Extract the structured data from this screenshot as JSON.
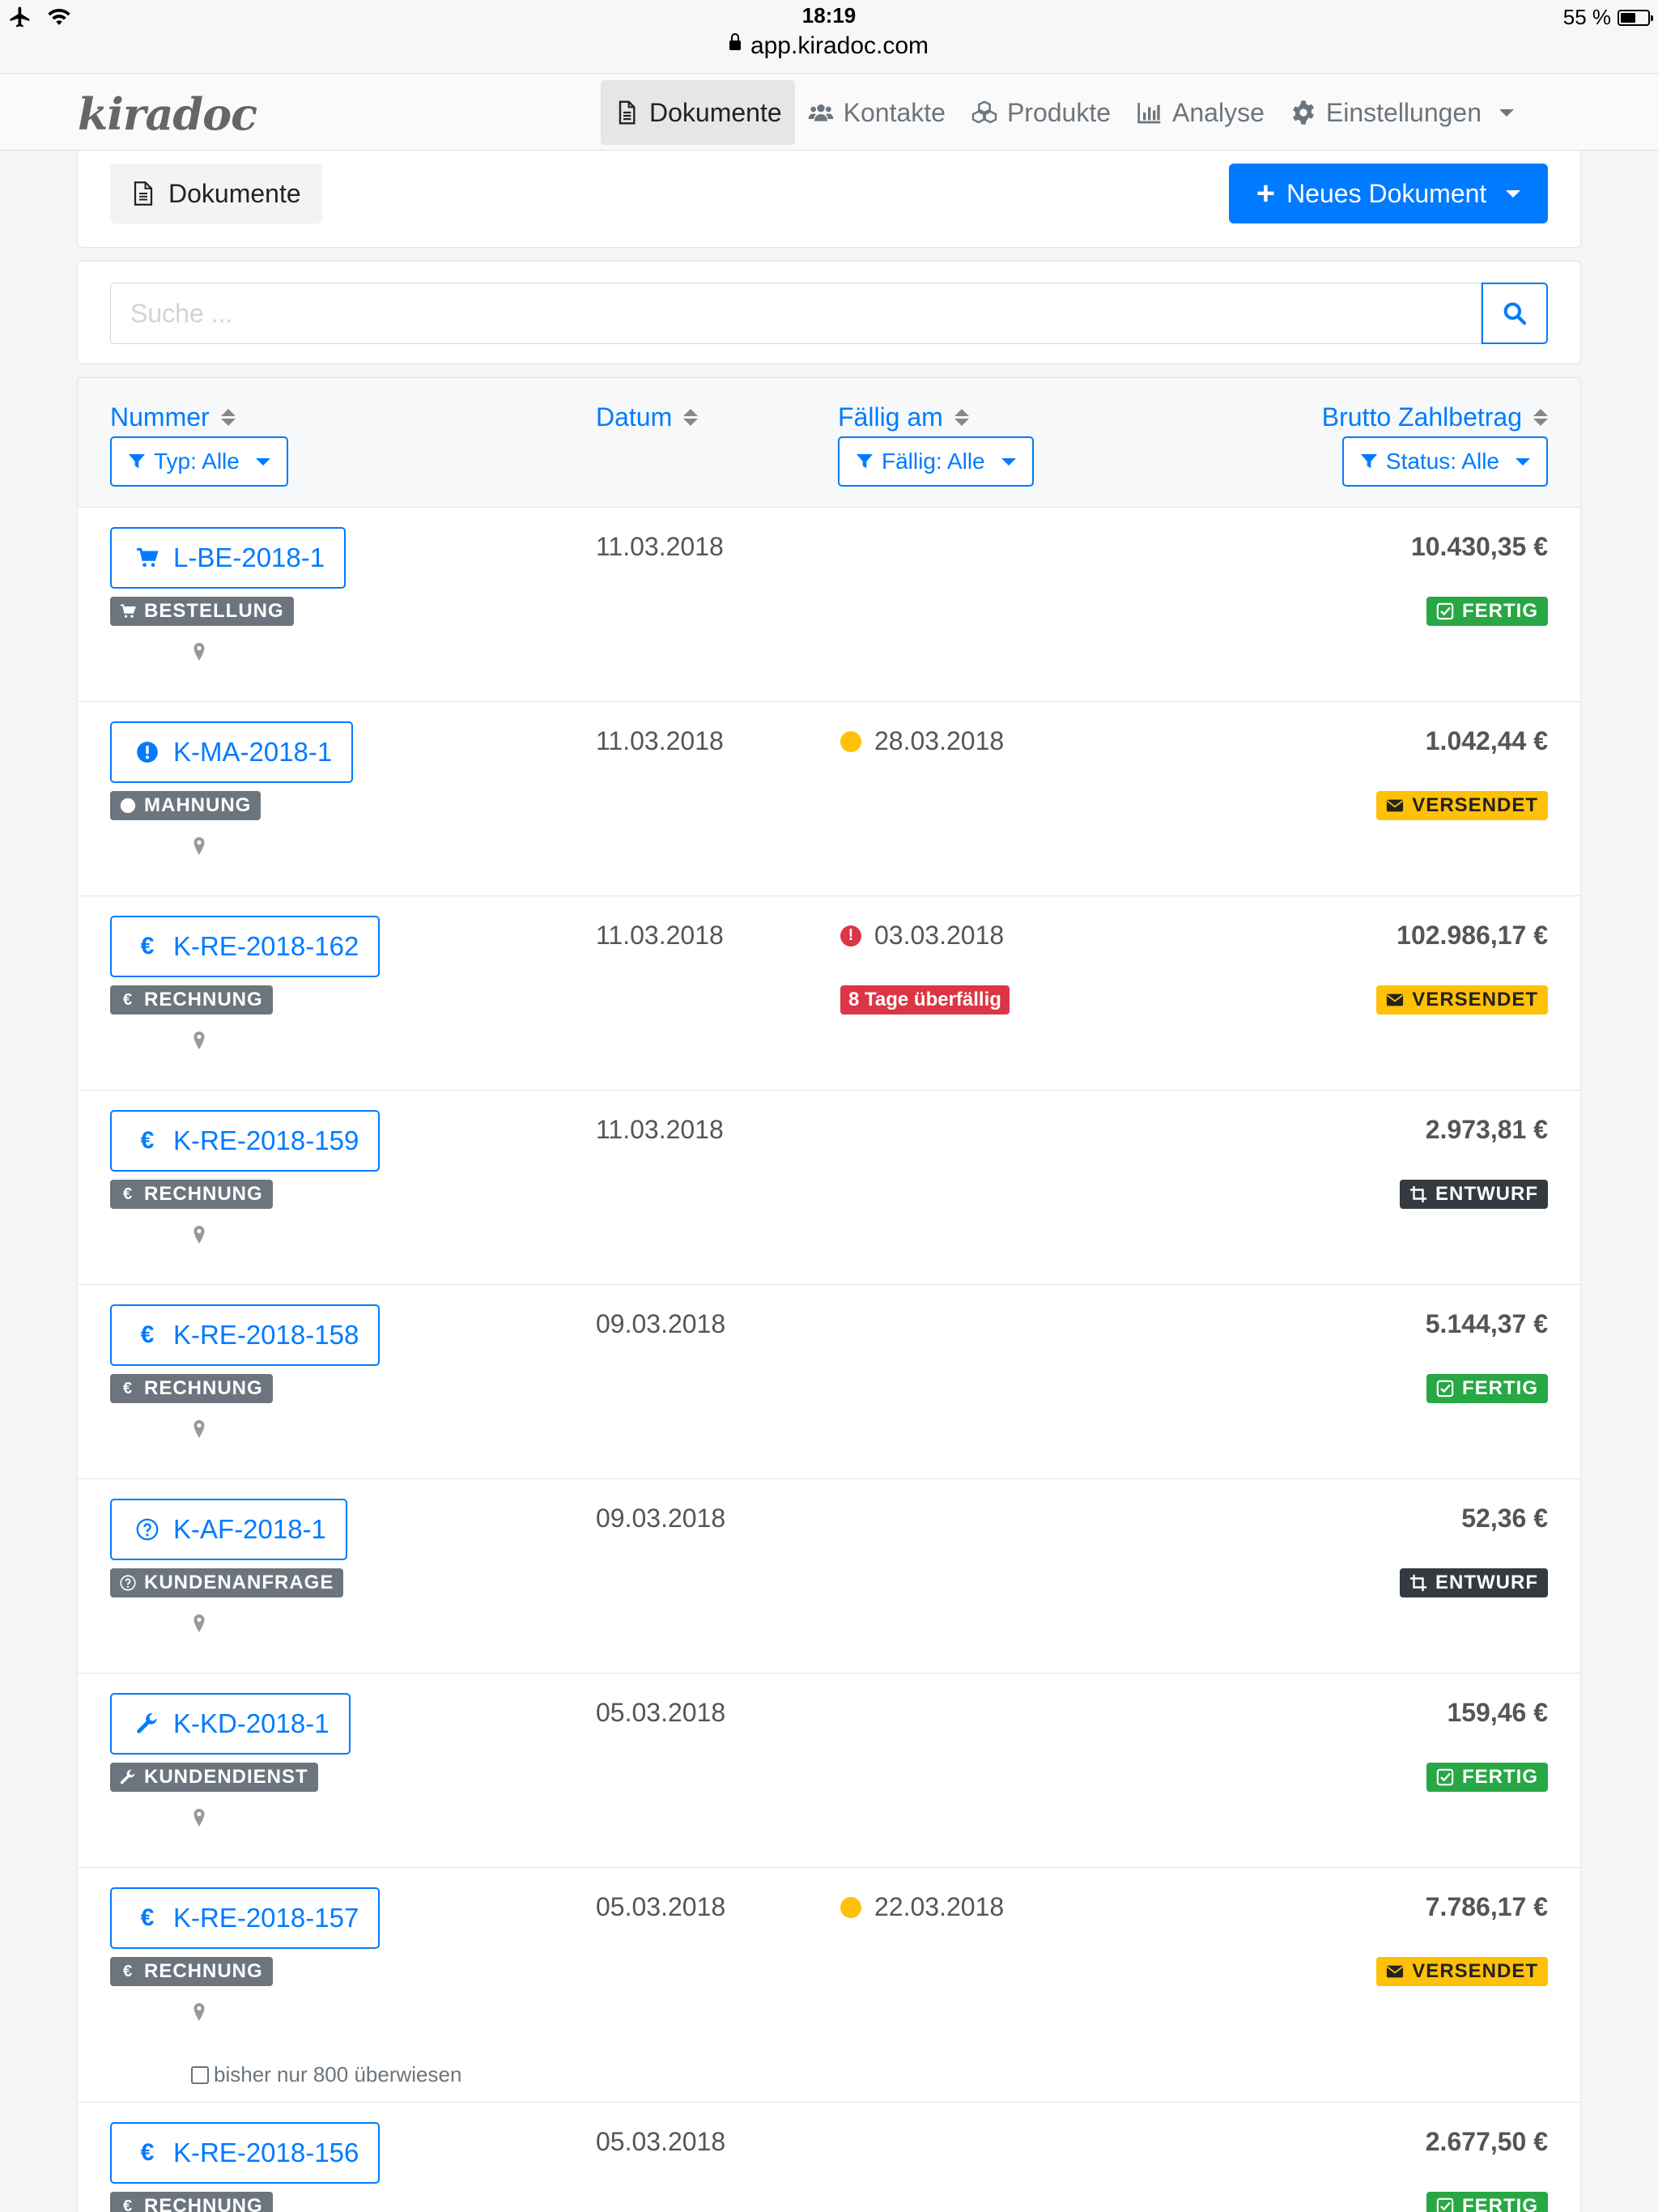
{
  "status_bar": {
    "time": "18:19",
    "url": "app.kiradoc.com",
    "battery": "55 %"
  },
  "brand": "kiradoc",
  "nav": [
    {
      "label": "Dokumente",
      "icon": "document-icon",
      "active": true
    },
    {
      "label": "Kontakte",
      "icon": "users-icon"
    },
    {
      "label": "Produkte",
      "icon": "cubes-icon"
    },
    {
      "label": "Analyse",
      "icon": "bar-chart-icon"
    },
    {
      "label": "Einstellungen",
      "icon": "gear-icon"
    }
  ],
  "header": {
    "title": "Dokumente",
    "new_button": "Neues Dokument"
  },
  "search": {
    "placeholder": "Suche ..."
  },
  "table": {
    "columns": [
      "Nummer",
      "Datum",
      "Fällig am",
      "Brutto Zahlbetrag"
    ],
    "filters": {
      "type": "Typ: Alle",
      "due": "Fällig: Alle",
      "status": "Status: Alle"
    }
  },
  "rows": [
    {
      "number": "L-BE-2018-1",
      "type": "BESTELLUNG",
      "icon": "cart",
      "date": "11.03.2018",
      "due": "",
      "due_state": "",
      "overdue": "",
      "amount": "10.430,35 €",
      "status": "FERTIG",
      "status_kind": "fertig",
      "note": ""
    },
    {
      "number": "K-MA-2018-1",
      "type": "MAHNUNG",
      "icon": "exclam",
      "date": "11.03.2018",
      "due": "28.03.2018",
      "due_state": "warn",
      "overdue": "",
      "amount": "1.042,44 €",
      "status": "VERSENDET",
      "status_kind": "versendet",
      "note": ""
    },
    {
      "number": "K-RE-2018-162",
      "type": "RECHNUNG",
      "icon": "euro",
      "date": "11.03.2018",
      "due": "03.03.2018",
      "due_state": "danger",
      "overdue": "8 Tage überfällig",
      "amount": "102.986,17 €",
      "status": "VERSENDET",
      "status_kind": "versendet",
      "note": ""
    },
    {
      "number": "K-RE-2018-159",
      "type": "RECHNUNG",
      "icon": "euro",
      "date": "11.03.2018",
      "due": "",
      "due_state": "",
      "overdue": "",
      "amount": "2.973,81 €",
      "status": "ENTWURF",
      "status_kind": "entwurf",
      "note": ""
    },
    {
      "number": "K-RE-2018-158",
      "type": "RECHNUNG",
      "icon": "euro",
      "date": "09.03.2018",
      "due": "",
      "due_state": "",
      "overdue": "",
      "amount": "5.144,37 €",
      "status": "FERTIG",
      "status_kind": "fertig",
      "note": ""
    },
    {
      "number": "K-AF-2018-1",
      "type": "KUNDENANFRAGE",
      "icon": "question",
      "date": "09.03.2018",
      "due": "",
      "due_state": "",
      "overdue": "",
      "amount": "52,36 €",
      "status": "ENTWURF",
      "status_kind": "entwurf",
      "note": ""
    },
    {
      "number": "K-KD-2018-1",
      "type": "KUNDENDIENST",
      "icon": "wrench",
      "date": "05.03.2018",
      "due": "",
      "due_state": "",
      "overdue": "",
      "amount": "159,46 €",
      "status": "FERTIG",
      "status_kind": "fertig",
      "note": ""
    },
    {
      "number": "K-RE-2018-157",
      "type": "RECHNUNG",
      "icon": "euro",
      "date": "05.03.2018",
      "due": "22.03.2018",
      "due_state": "warn",
      "overdue": "",
      "amount": "7.786,17 €",
      "status": "VERSENDET",
      "status_kind": "versendet",
      "note": "bisher nur 800 überwiesen"
    },
    {
      "number": "K-RE-2018-156",
      "type": "RECHNUNG",
      "icon": "euro",
      "date": "05.03.2018",
      "due": "",
      "due_state": "",
      "overdue": "",
      "amount": "2.677,50 €",
      "status": "FERTIG",
      "status_kind": "fertig",
      "note": ""
    }
  ],
  "colors": {
    "primary": "#007bff",
    "success": "#28a745",
    "warning": "#ffc107",
    "danger": "#dc3545",
    "dark": "#343a40",
    "secondary": "#6c757d"
  }
}
